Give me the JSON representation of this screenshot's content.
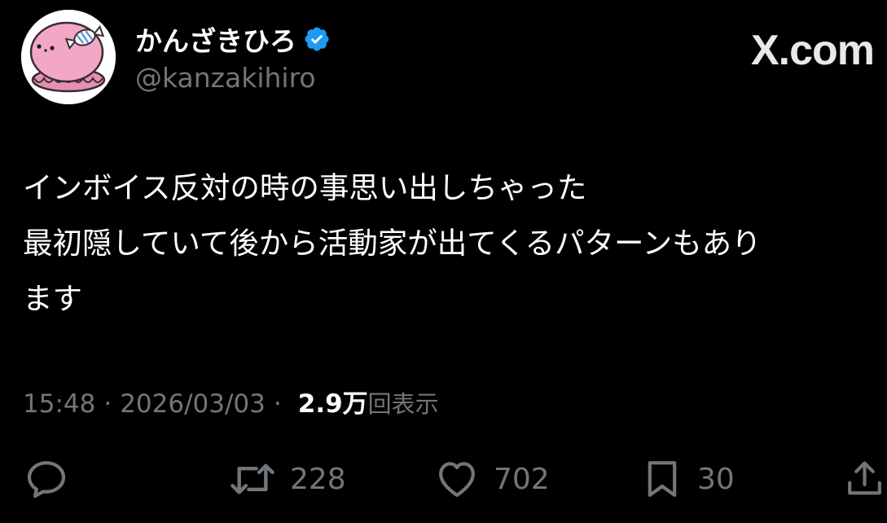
{
  "author": {
    "display_name": "かんざきひろ",
    "handle": "@kanzakihiro",
    "verified_icon": "verified-badge-icon"
  },
  "brand": "X.com",
  "tweet": {
    "lines": [
      "インボイス反対の時の事思い出しちゃった",
      "最初隠していて後から活動家が出てくるパターンもあり",
      "ます"
    ]
  },
  "meta": {
    "time": "15:48",
    "separator": "·",
    "date": "2026/03/03",
    "views_count": "2.9万",
    "views_label": "回表示"
  },
  "actions": {
    "reply": {
      "icon": "reply-icon"
    },
    "retweet": {
      "icon": "retweet-icon",
      "count": "228"
    },
    "like": {
      "icon": "heart-icon",
      "count": "702"
    },
    "bookmark": {
      "icon": "bookmark-icon",
      "count": "30"
    },
    "share": {
      "icon": "share-icon"
    }
  },
  "colors": {
    "background": "#000000",
    "text_primary": "#ffffff",
    "text_secondary": "#71767b",
    "verified": "#1d9bf0",
    "avatar_pink": "#f2a7c6"
  }
}
